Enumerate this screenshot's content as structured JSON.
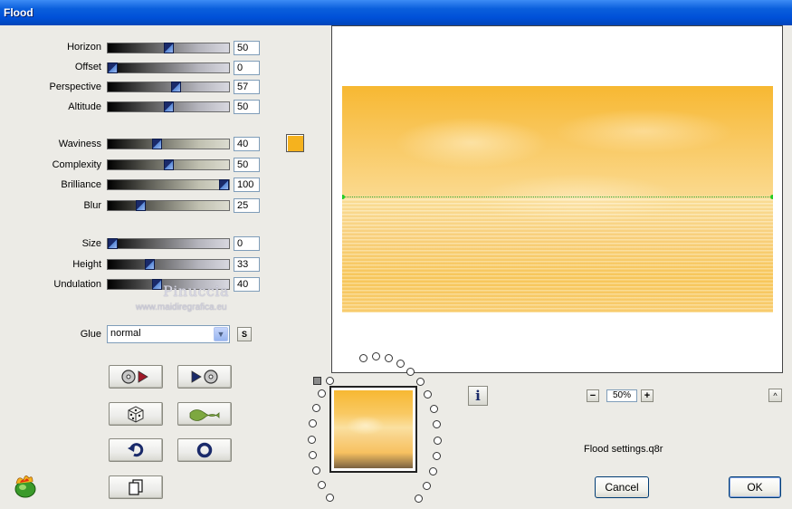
{
  "window": {
    "title": "Flood"
  },
  "parameters": [
    {
      "label": "Horizon",
      "value": "50",
      "percent": 50
    },
    {
      "label": "Offset",
      "value": "0",
      "percent": 0
    },
    {
      "label": "Perspective",
      "value": "57",
      "percent": 57
    },
    {
      "label": "Altitude",
      "value": "50",
      "percent": 50
    },
    {
      "label": "Waviness",
      "value": "40",
      "percent": 40
    },
    {
      "label": "Complexity",
      "value": "50",
      "percent": 50
    },
    {
      "label": "Brilliance",
      "value": "100",
      "percent": 100
    },
    {
      "label": "Blur",
      "value": "25",
      "percent": 25
    },
    {
      "label": "Size",
      "value": "0",
      "percent": 0
    },
    {
      "label": "Height",
      "value": "33",
      "percent": 33
    },
    {
      "label": "Undulation",
      "value": "40",
      "percent": 40
    }
  ],
  "color_swatch": "#f5b21e",
  "watermark": {
    "name": "Pinuccia",
    "url": "www.maidiregrafica.eu"
  },
  "glue": {
    "label": "Glue",
    "selected": "normal",
    "s_button": "S"
  },
  "zoom": {
    "minus": "−",
    "value": "50%",
    "plus": "+"
  },
  "info_label": "i",
  "caret_label": "^",
  "status": "Flood settings.q8r",
  "buttons": {
    "cancel": "Cancel",
    "ok": "OK"
  },
  "icons": {
    "toolbar": [
      "load-preset-icon",
      "save-preset-icon",
      "dice-random-icon",
      "wave-icon",
      "undo-icon",
      "reset-icon",
      "copy-icon"
    ],
    "logo": "flaming-pear-logo-icon"
  }
}
